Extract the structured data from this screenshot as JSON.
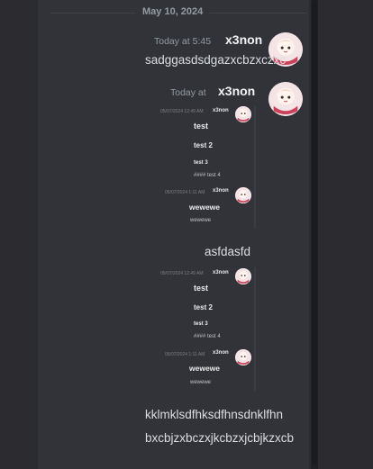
{
  "date_divider": "May 10, 2024",
  "messages": [
    {
      "timestamp": "Today at 5:45",
      "username": "x3non",
      "text": "sadggasdsdgazxcbzxczxc"
    },
    {
      "timestamp": "Today at",
      "username": "x3non",
      "embed1": {
        "time_a": "05/07/2024 12:49 AM",
        "user_a": "x3non",
        "h1": "test",
        "h2": "test 2",
        "h3": "test 3",
        "line4": "#### test 4",
        "time_b": "05/07/2024 1:11 AM",
        "user_b": "x3non",
        "bold": "wewewe",
        "small": "wewewe"
      },
      "middle_text": "asfdasfd",
      "embed2": {
        "time_a": "05/07/2024 12:49 AM",
        "user_a": "x3non",
        "h1": "test",
        "h2": "test 2",
        "h3": "test 3",
        "line4": "#### test 4",
        "time_b": "05/07/2024 1:11 AM",
        "user_b": "x3non",
        "bold": "wewewe",
        "small": "wewewe"
      },
      "line1": "kklmklsdfhksdfhnsdnklfhn",
      "line2": "bxcbjzxbczxjkcbzxjcbjkzxcb"
    }
  ]
}
